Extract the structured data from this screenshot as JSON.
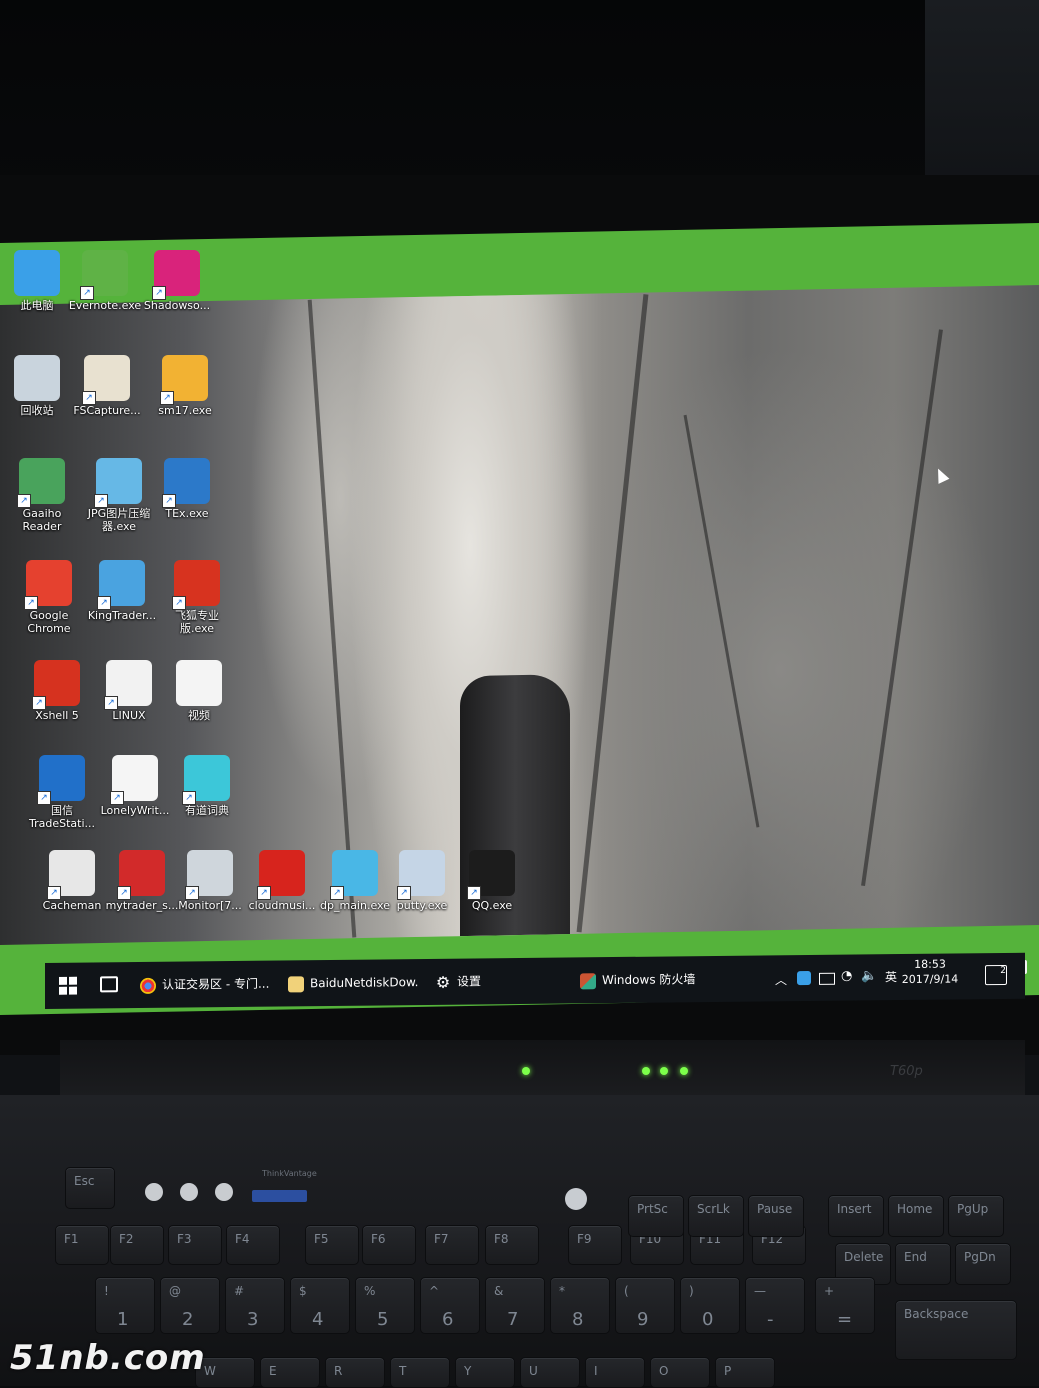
{
  "desktop": {
    "icons": [
      {
        "label": "此电脑",
        "icon": "this-pc-icon",
        "shortcut": false
      },
      {
        "label": "Evernote.exe",
        "icon": "evernote-icon",
        "shortcut": true
      },
      {
        "label": "Shadowso...",
        "icon": "shadowsocks-icon",
        "shortcut": true
      },
      {
        "label": "回收站",
        "icon": "recycle-bin-icon",
        "shortcut": false
      },
      {
        "label": "FSCapture...",
        "icon": "fscapture-icon",
        "shortcut": true
      },
      {
        "label": "sm17.exe",
        "icon": "sm17-icon",
        "shortcut": true
      },
      {
        "label": "Gaaiho Reader",
        "icon": "pdf-reader-icon",
        "shortcut": true
      },
      {
        "label": "JPG图片压缩器.exe",
        "icon": "jpg-compressor-icon",
        "shortcut": true
      },
      {
        "label": "TEx.exe",
        "icon": "tex-icon",
        "shortcut": true
      },
      {
        "label": "Google Chrome",
        "icon": "chrome-icon",
        "shortcut": true
      },
      {
        "label": "KingTrader...",
        "icon": "kingtrader-icon",
        "shortcut": true
      },
      {
        "label": "飞狐专业版.exe",
        "icon": "feihu-icon",
        "shortcut": true
      },
      {
        "label": "Xshell 5",
        "icon": "xshell-icon",
        "shortcut": true
      },
      {
        "label": "LINUX",
        "icon": "linux-folder-icon",
        "shortcut": true
      },
      {
        "label": "视频",
        "icon": "video-file-icon",
        "shortcut": false
      },
      {
        "label": "国信 TradeStati...",
        "icon": "tradestation-icon",
        "shortcut": true
      },
      {
        "label": "LonelyWrit...",
        "icon": "lonelywriter-icon",
        "shortcut": true
      },
      {
        "label": "有道词典",
        "icon": "youdao-icon",
        "shortcut": true
      },
      {
        "label": "Cacheman",
        "icon": "cacheman-icon",
        "shortcut": true
      },
      {
        "label": "mytrader_s...",
        "icon": "mytrader-icon",
        "shortcut": true
      },
      {
        "label": "Monitor[7...",
        "icon": "monitor-icon",
        "shortcut": true
      },
      {
        "label": "cloudmusi...",
        "icon": "cloudmusic-icon",
        "shortcut": true
      },
      {
        "label": "dp_main.exe",
        "icon": "dp-main-icon",
        "shortcut": true
      },
      {
        "label": "putty.exe",
        "icon": "putty-icon",
        "shortcut": true
      },
      {
        "label": "QQ.exe",
        "icon": "qq-icon",
        "shortcut": true
      }
    ]
  },
  "taskbar": {
    "items": [
      {
        "label": "认证交易区 - 专门...",
        "icon": "chrome-icon"
      },
      {
        "label": "BaiduNetdiskDow...",
        "icon": "folder-icon"
      },
      {
        "label": "设置",
        "icon": "gear-icon"
      },
      {
        "label": "Windows 防火墙",
        "icon": "firewall-icon"
      }
    ],
    "tray": {
      "ime": "英",
      "time": "18:53",
      "date": "2017/9/14",
      "notifications": "2"
    }
  },
  "laptop": {
    "model": "T60p",
    "brand_label": "ThinkVantage",
    "keys_row_fn": [
      "Esc",
      "F1",
      "F2",
      "F3",
      "F4",
      "F5",
      "F6",
      "F7",
      "F8",
      "F9",
      "F10",
      "F11",
      "F12"
    ],
    "keys_nav": [
      "PrtSc",
      "ScrLk",
      "Pause",
      "Insert",
      "Home",
      "PgUp",
      "Delete",
      "End",
      "PgDn"
    ],
    "keys_num_row": [
      "!",
      "@",
      "#",
      "$",
      "%",
      "^",
      "&",
      "*",
      "(",
      ")",
      "—",
      "+",
      "Backspace"
    ],
    "keys_num_digits": [
      "1",
      "2",
      "3",
      "4",
      "5",
      "6",
      "7",
      "8",
      "9",
      "0",
      "-",
      "="
    ],
    "keys_bottom": [
      "W",
      "E",
      "R",
      "T",
      "Y",
      "U",
      "I",
      "O",
      "P"
    ]
  },
  "watermark": "51nb.com"
}
